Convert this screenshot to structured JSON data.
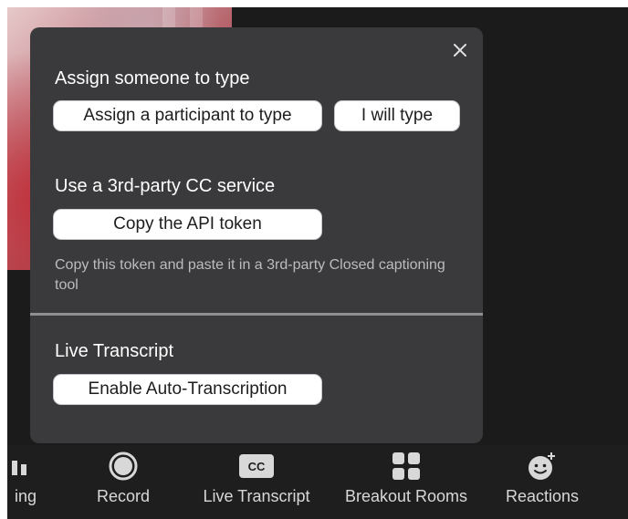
{
  "popup": {
    "sections": [
      {
        "title": "Assign someone to type",
        "buttons": [
          "Assign a participant to type",
          "I will type"
        ]
      },
      {
        "title": "Use a 3rd-party CC service",
        "buttons": [
          "Copy the API token"
        ],
        "hint": "Copy this token and paste it in a 3rd-party Closed captioning tool"
      },
      {
        "title": "Live Transcript",
        "buttons": [
          "Enable Auto-Transcription"
        ]
      }
    ]
  },
  "toolbar": {
    "items": [
      {
        "label": "ing",
        "icon": "recording-icon"
      },
      {
        "label": "Record",
        "icon": "record-icon"
      },
      {
        "label": "Live Transcript",
        "icon": "cc-icon",
        "badge": "CC"
      },
      {
        "label": "Breakout Rooms",
        "icon": "breakout-rooms-icon"
      },
      {
        "label": "Reactions",
        "icon": "reactions-icon"
      }
    ]
  },
  "colors": {
    "popup_bg": "#3a3a3c",
    "toolbar_bg": "#1e1e1e",
    "button_bg": "#ffffff",
    "divider": "#8e8e93"
  }
}
